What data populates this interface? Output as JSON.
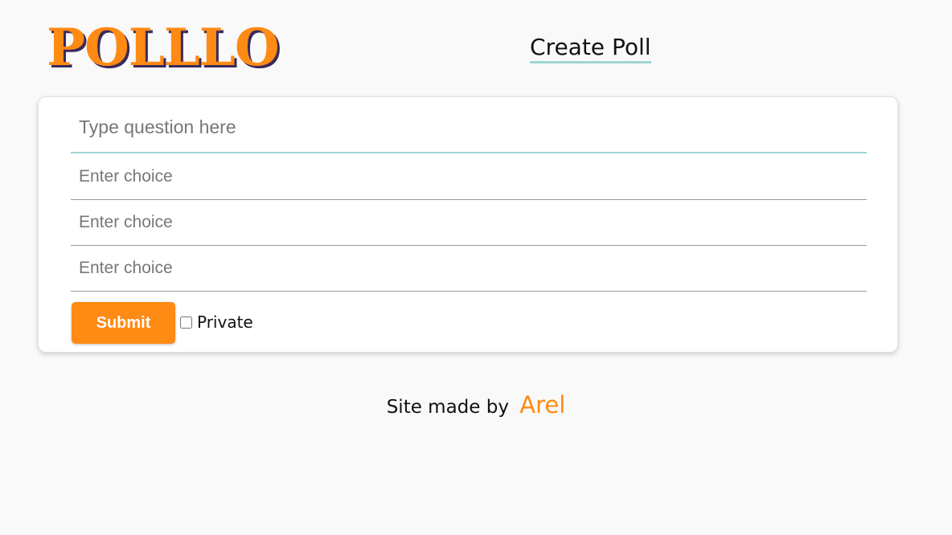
{
  "header": {
    "logo_text": "POLLLO",
    "nav_create_poll": "Create Poll"
  },
  "form": {
    "question_placeholder": "Type question here",
    "choices": [
      {
        "placeholder": "Enter choice"
      },
      {
        "placeholder": "Enter choice"
      },
      {
        "placeholder": "Enter choice"
      }
    ],
    "submit_label": "Submit",
    "private_label": "Private",
    "private_checked": false
  },
  "footer": {
    "prefix": "Site made by",
    "author": "Arel"
  },
  "colors": {
    "accent_orange": "#ff8a14",
    "accent_teal": "#9fd6d4",
    "logo_shadow": "#3a2a5c",
    "background": "#f9f9f9"
  },
  "icons": {
    "private_checkbox": "checkbox-unchecked"
  }
}
